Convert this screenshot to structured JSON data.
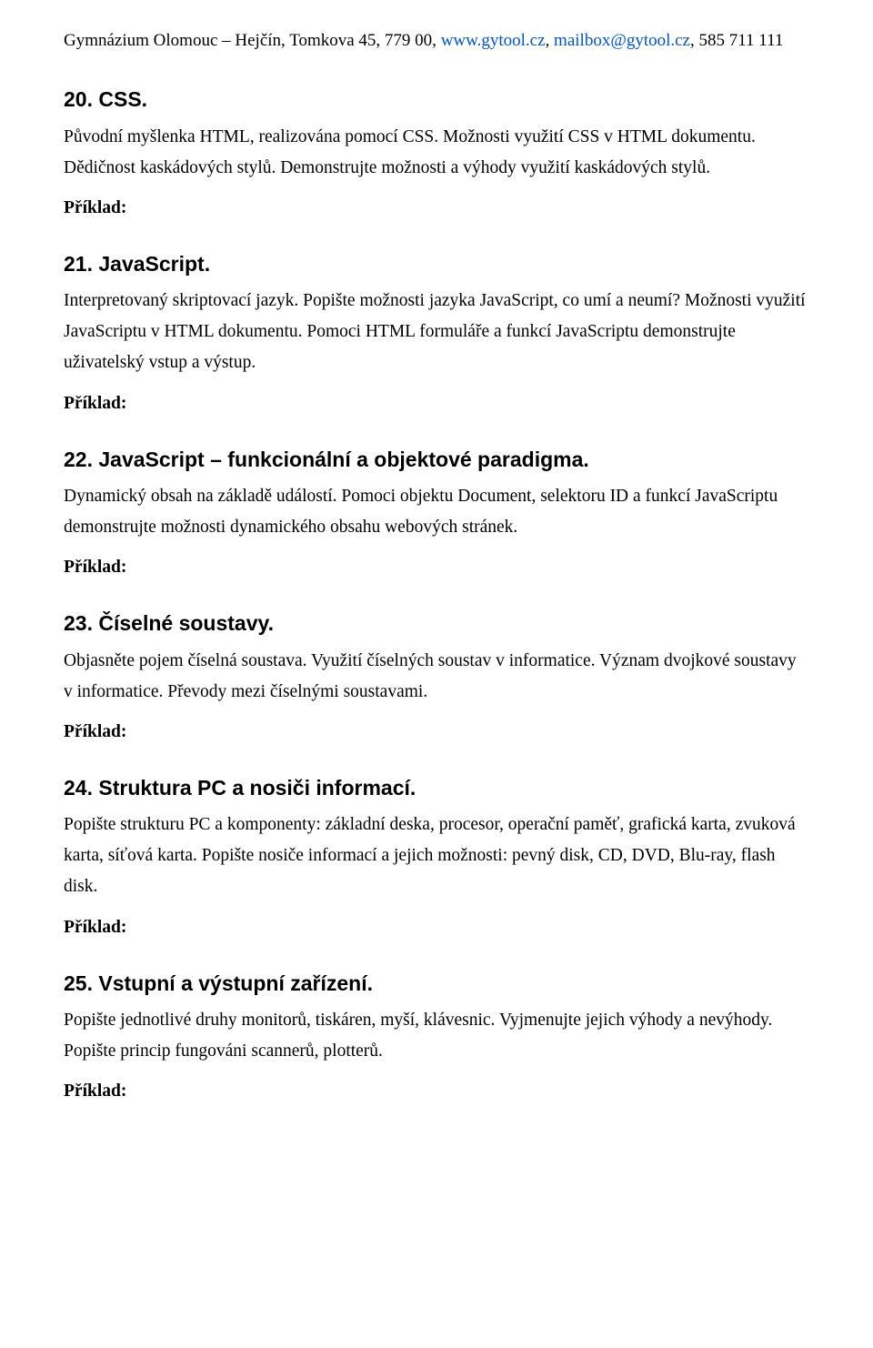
{
  "header": {
    "prefix": "Gymnázium Olomouc – Hejčín, Tomkova 45, 779 00, ",
    "link1": "www.gytool.cz",
    "sep1": ", ",
    "link2": "mailbox@gytool.cz",
    "suffix": ", 585 711 111"
  },
  "sections": [
    {
      "heading": "20. CSS.",
      "body": "Původní myšlenka HTML, realizována pomocí CSS. Možnosti využití CSS v HTML dokumentu. Dědičnost kaskádových stylů. Demonstrujte možnosti a výhody využití kaskádových stylů.",
      "example": "Příklad:"
    },
    {
      "heading": "21. JavaScript.",
      "body": "Interpretovaný skriptovací jazyk. Popište možnosti jazyka JavaScript, co umí a neumí? Možnosti využití JavaScriptu v HTML dokumentu. Pomoci HTML formuláře a funkcí JavaScriptu demonstrujte uživatelský vstup a výstup.",
      "example": "Příklad:"
    },
    {
      "heading": "22. JavaScript – funkcionální a objektové paradigma.",
      "body": "Dynamický obsah na základě událostí. Pomoci objektu Document, selektoru ID a funkcí JavaScriptu demonstrujte možnosti dynamického obsahu webových stránek.",
      "example": "Příklad:"
    },
    {
      "heading": "23. Číselné soustavy.",
      "body": "Objasněte pojem číselná soustava. Využití číselných soustav v informatice. Význam dvojkové soustavy v informatice. Převody mezi číselnými soustavami.",
      "example": "Příklad:"
    },
    {
      "heading": "24. Struktura PC a nosiči informací.",
      "body": "Popište strukturu PC a komponenty: základní deska, procesor, operační paměť, grafická karta, zvuková karta, síťová karta. Popište nosiče informací a jejich možnosti: pevný disk, CD, DVD, Blu-ray, flash disk.",
      "example": "Příklad:"
    },
    {
      "heading": "25. Vstupní a výstupní zařízení.",
      "body": "Popište jednotlivé druhy monitorů, tiskáren, myší, klávesnic. Vyjmenujte jejich výhody a nevýhody. Popište princip fungováni scannerů, plotterů.",
      "example": "Příklad:"
    }
  ]
}
